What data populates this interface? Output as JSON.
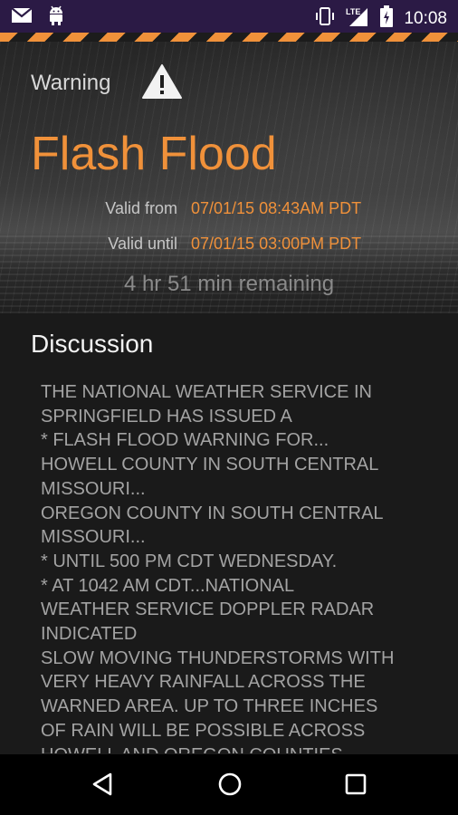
{
  "status_bar": {
    "icons": [
      "mail-icon",
      "android-icon",
      "vibrate-icon",
      "lte-signal-icon",
      "battery-charging-icon"
    ],
    "network": "LTE",
    "time": "10:08"
  },
  "alert": {
    "category": "Warning",
    "icon": "warning-triangle-icon",
    "title": "Flash Flood",
    "valid_from_label": "Valid from",
    "valid_from_value": "07/01/15 08:43AM PDT",
    "valid_until_label": "Valid until",
    "valid_until_value": "07/01/15 03:00PM PDT",
    "remaining": "4 hr 51 min remaining"
  },
  "discussion": {
    "heading": "Discussion",
    "text": "THE NATIONAL WEATHER SERVICE IN\nSPRINGFIELD HAS ISSUED A\n* FLASH FLOOD WARNING FOR...\nHOWELL COUNTY IN SOUTH CENTRAL\nMISSOURI...\nOREGON COUNTY IN SOUTH CENTRAL\nMISSOURI...\n* UNTIL 500 PM CDT WEDNESDAY.\n* AT 1042 AM CDT...NATIONAL\nWEATHER SERVICE DOPPLER RADAR\nINDICATED\nSLOW MOVING THUNDERSTORMS WITH\nVERY HEAVY RAINFALL ACROSS THE\nWARNED AREA. UP TO THREE INCHES\nOF RAIN WILL BE POSSIBLE ACROSS\nHOWELL AND OREGON COUNTIES"
  },
  "colors": {
    "accent": "#f0913a",
    "status_bar": "#2b1a45",
    "background": "#1a1a1a"
  },
  "nav_bar": {
    "buttons": [
      "back-icon",
      "home-icon",
      "recents-icon"
    ]
  }
}
